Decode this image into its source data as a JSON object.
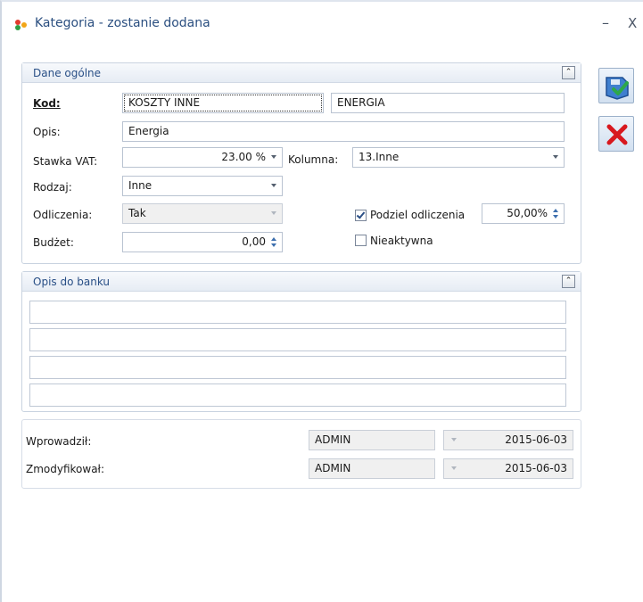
{
  "window": {
    "title": "Kategoria - zostanie dodana",
    "minimize_glyph": "–",
    "close_glyph": "X"
  },
  "general": {
    "header": "Dane ogólne",
    "kod_label": "Kod:",
    "kod_value": "KOSZTY INNE",
    "kod_name": "ENERGIA",
    "opis_label": "Opis:",
    "opis_value": "Energia",
    "vat_label": "Stawka VAT:",
    "vat_value": "23.00 %",
    "kolumna_label": "Kolumna:",
    "kolumna_value": "13.Inne",
    "rodzaj_label": "Rodzaj:",
    "rodzaj_value": "Inne",
    "odliczenia_label": "Odliczenia:",
    "odliczenia_value": "Tak",
    "podziel_label": "Podziel odliczenia",
    "podziel_checked": true,
    "podziel_value": "50,00%",
    "budzet_label": "Budżet:",
    "budzet_value": "0,00",
    "nieaktywna_label": "Nieaktywna",
    "nieaktywna_checked": false
  },
  "bank": {
    "header": "Opis do banku",
    "lines": [
      "",
      "",
      "",
      ""
    ]
  },
  "audit": {
    "created_label": "Wprowadził:",
    "created_user": "ADMIN",
    "created_date": "2015-06-03",
    "modified_label": "Zmodyfikował:",
    "modified_user": "ADMIN",
    "modified_date": "2015-06-03"
  },
  "icons": {
    "app": "app-logo-icon",
    "save": "save-icon",
    "cancel": "cancel-icon",
    "collapse": "collapse-up-icon"
  },
  "colors": {
    "title": "#2b4f80",
    "panel_header": "#294f86",
    "cancel_red": "#d8181e",
    "save_check": "#2ea84a"
  }
}
